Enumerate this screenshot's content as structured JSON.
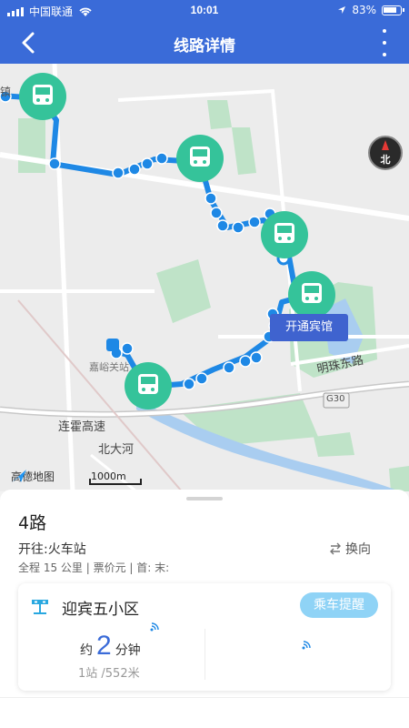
{
  "status_bar": {
    "carrier": "中国联通",
    "time": "10:01",
    "battery": "83%"
  },
  "nav": {
    "title": "线路详情"
  },
  "map": {
    "compass_label": "北",
    "stop_tag": "开通宾馆",
    "labels": {
      "road_mingzhu": "明珠东路",
      "highway_lianhuo": "连霍高速",
      "river_beida": "北大河",
      "highway_g30": "G30",
      "poi_jiayu": "嘉峪关站",
      "fragment_top": "镇"
    },
    "brand": "高德地图",
    "scale": "1000m",
    "route_color": "#1e88e5",
    "stop_color": "#35c39a"
  },
  "route": {
    "name": "4路",
    "direction": "开往:火车站",
    "swap_label": "换向",
    "summary": "全程 15 公里 | 票价元 | 首: 末:"
  },
  "stop_card": {
    "stop_name": "迎宾五小区",
    "remind_button": "乘车提醒",
    "eta_prefix": "约",
    "eta_minutes": "2",
    "eta_unit": "分钟",
    "distance": "1站 /552米"
  }
}
